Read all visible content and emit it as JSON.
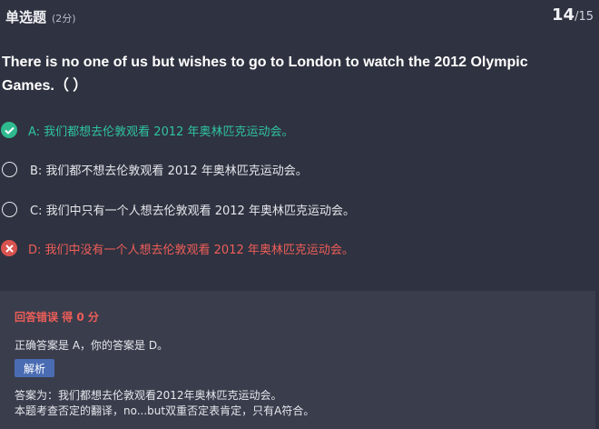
{
  "header": {
    "question_type": "单选题",
    "score": "(2分)",
    "progress_current": "14",
    "progress_total": "/15"
  },
  "question": {
    "text": "There is no one of us but wishes to go to London to watch the 2012 Olympic Games.（  ）"
  },
  "options": [
    {
      "label": "A: 我们都想去伦敦观看 2012 年奥林匹克运动会。",
      "state": "correct",
      "icon": "check-icon",
      "color": "#2fc3a0"
    },
    {
      "label": "B: 我们都不想去伦敦观看 2012 年奥林匹克运动会。",
      "state": "unselected",
      "icon": "radio-empty-icon"
    },
    {
      "label": "C: 我们中只有一个人想去伦敦观看 2012 年奥林匹克运动会。",
      "state": "unselected",
      "icon": "radio-empty-icon"
    },
    {
      "label": "D: 我们中没有一个人想去伦敦观看 2012 年奥林匹克运动会。",
      "state": "wrong",
      "icon": "x-icon",
      "color": "#ee5e59"
    }
  ],
  "feedback": {
    "result": "回答错误 得 0 分",
    "answer_line": "正确答案是 A，你的答案是 D。",
    "analysis_button": "解析",
    "analysis_line1": "答案为：我们都想去伦敦观看2012年奥林匹克运动会。",
    "analysis_line2": "本题考查否定的翻译，no...but双重否定表肯定，只有A符合。"
  },
  "colors": {
    "background": "#2f3240",
    "panel": "#3a3d4c",
    "correct": "#2fb98f",
    "wrong": "#d9534f",
    "button": "#4a6cb3"
  }
}
